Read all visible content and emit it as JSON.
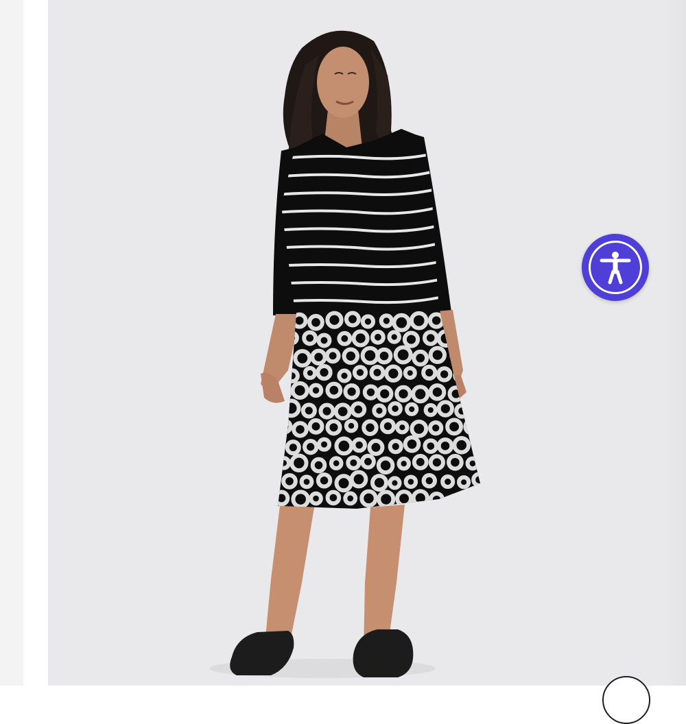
{
  "page": {
    "background": "#ffffff",
    "side_strip_color": "#f3f3f3",
    "photo_background": "#e9e9eb"
  },
  "product_image": {
    "icon": "product-photo",
    "garment": {
      "bodice_color": "#0d0d0d",
      "stripe_color": "#e8e8e8",
      "dot_color": "#dcdcdc"
    },
    "shoe_color": "#1c1c1c"
  },
  "accessibility_button": {
    "icon": "accessibility-person-icon",
    "color": "#4f3fd6"
  },
  "corner_control": {
    "icon": "circle-icon"
  }
}
